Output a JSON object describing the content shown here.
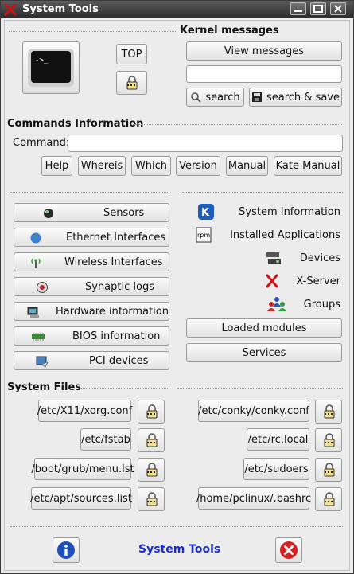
{
  "window": {
    "title": "System Tools"
  },
  "top_button": "TOP",
  "kernel": {
    "heading": "Kernel messages",
    "view_label": "View messages",
    "search_value": "",
    "search_label": "search",
    "search_save_label": "search & save"
  },
  "commands": {
    "heading": "Commands Information",
    "command_label": "Command:",
    "command_value": "",
    "buttons": [
      "Help",
      "Whereis",
      "Which",
      "Version",
      "Manual",
      "Kate Manual"
    ]
  },
  "tools_left": [
    {
      "label": "Sensors",
      "icon": "sensors-icon"
    },
    {
      "label": "Ethernet Interfaces",
      "icon": "globe-icon"
    },
    {
      "label": "Wireless Interfaces",
      "icon": "wireless-icon"
    },
    {
      "label": "Synaptic logs",
      "icon": "synaptic-icon"
    },
    {
      "label": "Hardware information",
      "icon": "hardware-icon"
    },
    {
      "label": "BIOS information",
      "icon": "bios-chip-icon"
    },
    {
      "label": "PCI devices",
      "icon": "pci-icon"
    }
  ],
  "tools_right": [
    {
      "label": "System Information",
      "icon": "kde-icon"
    },
    {
      "label": "Installed Applications",
      "icon": "rpm-icon"
    },
    {
      "label": "Devices",
      "icon": "devices-icon"
    },
    {
      "label": "X-Server",
      "icon": "x-server-icon"
    },
    {
      "label": "Groups",
      "icon": "groups-icon"
    }
  ],
  "module_buttons": {
    "loaded_modules": "Loaded modules",
    "services": "Services"
  },
  "system_files": {
    "heading": "System Files",
    "left": [
      "/etc/X11/xorg.conf",
      "/etc/fstab",
      "/boot/grub/menu.lst",
      "/etc/apt/sources.list"
    ],
    "right": [
      "/etc/conky/conky.conf",
      "/etc/rc.local",
      "/etc/sudoers",
      "/home/pclinux/.bashrc"
    ]
  },
  "footer": {
    "title": "System Tools",
    "title_color": "#1a2fd0"
  }
}
